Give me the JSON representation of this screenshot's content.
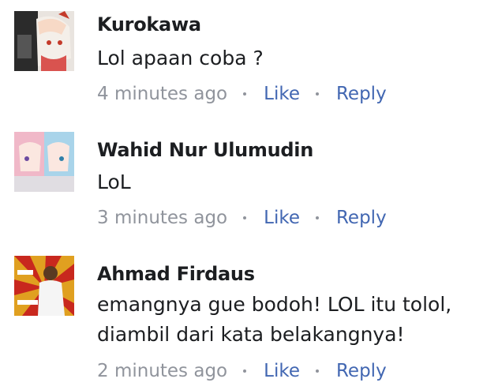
{
  "comments": [
    {
      "author": "Kurokawa",
      "lines": [
        "Lol apaan coba ?"
      ],
      "time": "4 minutes ago",
      "like_label": "Like",
      "reply_label": "Reply",
      "avatar_icon": "anime-girl-avatar"
    },
    {
      "author": "Wahid Nur Ulumudin",
      "lines": [
        "LoL"
      ],
      "time": "3 minutes ago",
      "like_label": "Like",
      "reply_label": "Reply",
      "avatar_icon": "anime-twins-avatar"
    },
    {
      "author": "Ahmad Firdaus",
      "lines": [
        "emangnya gue bodoh! LOL itu tolol,",
        "diambil dari kata belakangnya!"
      ],
      "time": "2 minutes ago",
      "like_label": "Like",
      "reply_label": "Reply",
      "avatar_icon": "person-sunburst-avatar"
    }
  ],
  "colors": {
    "link": "#4267b2",
    "meta": "#90949c",
    "text": "#1c1e21"
  }
}
